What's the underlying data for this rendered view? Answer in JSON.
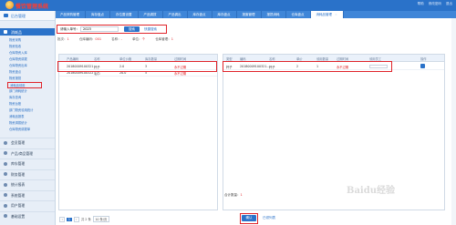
{
  "app": {
    "logo_text": "餐饮管理系统"
  },
  "header": {
    "links": [
      "帮助",
      "修改密码",
      "退出"
    ]
  },
  "tabs": [
    {
      "label": "产品采购管理",
      "active": false
    },
    {
      "label": "库存盘点",
      "active": false
    },
    {
      "label": "存位置设置",
      "active": false
    },
    {
      "label": "产品调拨",
      "active": false
    },
    {
      "label": "产品调出",
      "active": false
    },
    {
      "label": "库存盘点",
      "active": false
    },
    {
      "label": "库存盘点",
      "active": false
    },
    {
      "label": "报废管理",
      "active": false
    },
    {
      "label": "报损消耗",
      "active": false
    },
    {
      "label": "仓库盘点",
      "active": false
    },
    {
      "label": "消耗品管理",
      "active": true
    }
  ],
  "sidebar": {
    "title": "后台管理",
    "active_group": "消耗品",
    "items": [
      {
        "label": "物资采购",
        "highlight": false
      },
      {
        "label": "物资验收",
        "highlight": false
      },
      {
        "label": "仓库物资入库",
        "highlight": false
      },
      {
        "label": "仓库物资调拨",
        "highlight": false
      },
      {
        "label": "仓库物资出库",
        "highlight": false
      },
      {
        "label": "物资盘点",
        "highlight": false
      },
      {
        "label": "物资报损",
        "highlight": false
      },
      {
        "label": "消耗品领用",
        "highlight": true
      },
      {
        "label": "部门消耗统计",
        "highlight": false
      },
      {
        "label": "库存查询",
        "highlight": false
      },
      {
        "label": "物资台账",
        "highlight": false
      },
      {
        "label": "部门物资领用统计",
        "highlight": false
      },
      {
        "label": "消耗品报表",
        "highlight": false
      },
      {
        "label": "物资调拨统计",
        "highlight": false
      },
      {
        "label": "仓库物资调拨单",
        "highlight": false
      }
    ],
    "groups": [
      "会员管理",
      "产品/商品管理",
      "库存管理",
      "财务管理",
      "统计报表",
      "系统管理",
      "用户管理",
      "基础设置"
    ]
  },
  "search": {
    "label": "请输入单号：",
    "value": "2023",
    "button": "搜索",
    "more": "快捷搜索"
  },
  "filters": {
    "label1": "批次：",
    "val1": "1",
    "label2": "仓库编码：",
    "val2": "001",
    "label3": "名称：",
    "val3": "-",
    "label4": "单位：",
    "val4": "个",
    "label5": "仓库管理：",
    "val5": "1"
  },
  "left_table": {
    "headers": [
      "产品编码",
      "名称",
      "单位价格",
      "库存数量",
      "过期时间"
    ],
    "rows": [
      [
        "20180009100321",
        "杯子",
        "2.0",
        "3",
        "永不过期"
      ],
      [
        "20180009100322",
        "毛巾",
        "20.0",
        "5",
        "永不过期"
      ]
    ]
  },
  "right_table": {
    "headers": [
      "类型",
      "编码",
      "名称",
      "单价",
      "领用数量",
      "过期时间",
      "领用员工",
      "操作"
    ],
    "rows": [
      [
        "杯子",
        "20180009100321...",
        "杯子",
        "2",
        "1",
        "永不过期",
        "",
        ""
      ]
    ]
  },
  "summary": {
    "label": "合计数量：",
    "value": "1"
  },
  "actions": {
    "confirm": "确认",
    "return": "已领列表"
  },
  "pager": {
    "total": "共 2 条",
    "current": "1",
    "size": "10 条/页"
  },
  "watermark": "Baidu经验"
}
